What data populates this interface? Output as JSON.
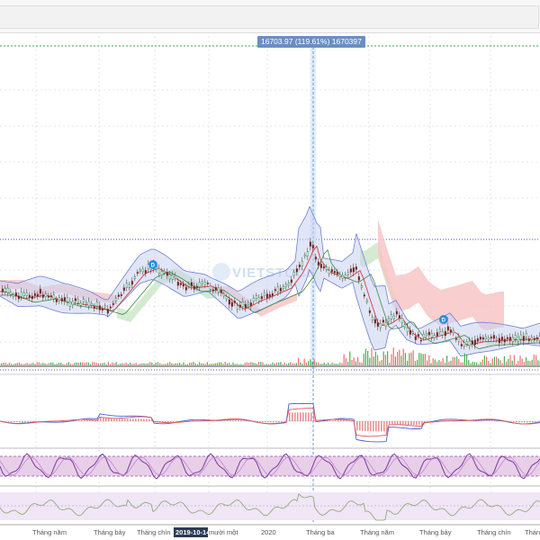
{
  "toolbar": {
    "label": ""
  },
  "crosshair": {
    "tooltip": "16703.97 (119.61%) 1670397"
  },
  "watermark": "VIETSTOCK",
  "dividend_markers": [
    {
      "label": "D"
    },
    {
      "label": "D"
    }
  ],
  "time_axis": {
    "labels": [
      "Tháng năm",
      "Tháng bảy",
      "Tháng chín",
      "mười một",
      "2020",
      "Tháng ba",
      "Tháng năm",
      "Tháng bảy",
      "Tháng chín",
      "Thán"
    ],
    "highlighted_date": "2019-10-14"
  },
  "colors": {
    "price_up": "#2e8b57",
    "price_down": "#d9534f",
    "cloud_bull": "#cde7c9",
    "cloud_bear": "#f7c6c6",
    "band_fill": "#c9d2f0",
    "band_line": "#6f7fd3",
    "kijun": "#d73a3a",
    "macd_line": "#4a5fd8",
    "signal_line": "#e05a5a",
    "stoch_zone": "#e8cfe8",
    "stoch_k": "#7a3a9a",
    "rsi_line": "#8aa46a",
    "crosshair": "#8fb3dd"
  },
  "chart_data": {
    "type": "line",
    "title": "",
    "xlabel": "",
    "ylabel": "",
    "x": [
      "Tháng năm",
      "Tháng bảy",
      "Tháng chín",
      "2019-10-14",
      "mười một",
      "2020",
      "Tháng ba",
      "Tháng năm",
      "Tháng bảy",
      "Tháng chín",
      "Thán"
    ],
    "series": [
      {
        "values": [
          0.28,
          0.3,
          0.26,
          0.34,
          0.28,
          0.3,
          0.48,
          0.36,
          0.18,
          0.12,
          0.14
        ]
      }
    ],
    "crosshair_readout": {
      "price": 16703.97,
      "percent": 119.61,
      "volume": 1670397
    },
    "grid": true,
    "legend": "none"
  }
}
